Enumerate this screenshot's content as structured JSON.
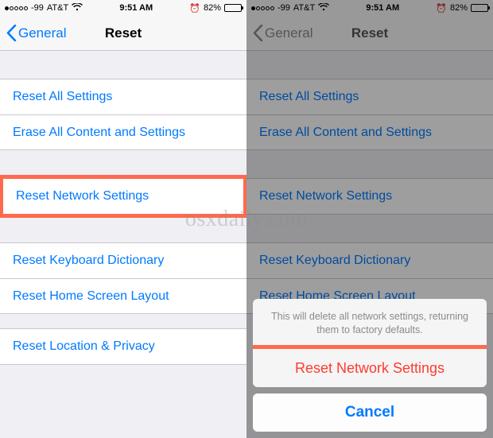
{
  "status": {
    "signal_label": "-99",
    "carrier": "AT&T",
    "time": "9:51 AM",
    "battery_pct": "82%"
  },
  "nav": {
    "back_label": "General",
    "title": "Reset"
  },
  "rows": {
    "reset_all": "Reset All Settings",
    "erase_all": "Erase All Content and Settings",
    "reset_network": "Reset Network Settings",
    "reset_keyboard": "Reset Keyboard Dictionary",
    "reset_home": "Reset Home Screen Layout",
    "reset_location": "Reset Location & Privacy"
  },
  "sheet": {
    "message": "This will delete all network settings, returning them to factory defaults.",
    "confirm": "Reset Network Settings",
    "cancel": "Cancel"
  },
  "watermark": "osxdaily.com"
}
